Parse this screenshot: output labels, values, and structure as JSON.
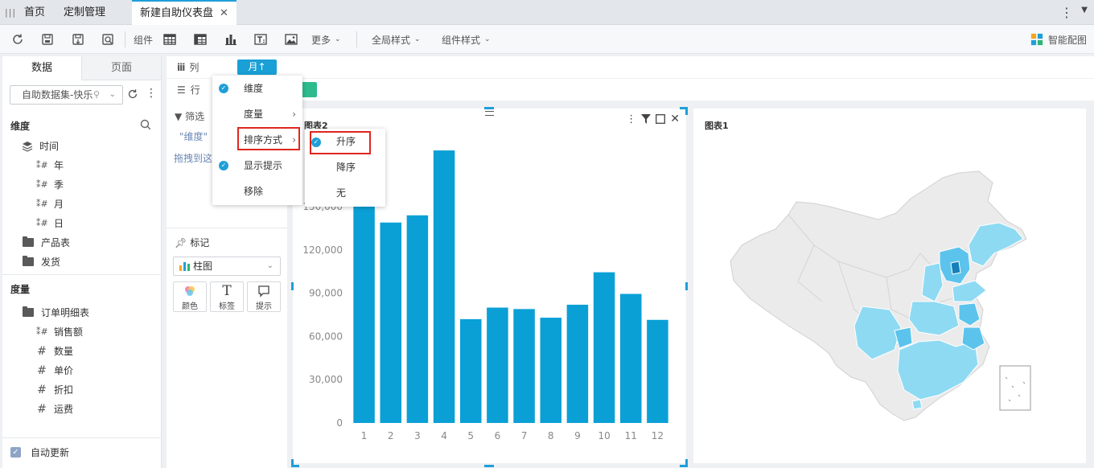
{
  "tabs": [
    {
      "label": "首页"
    },
    {
      "label": "定制管理"
    },
    {
      "label": "新建自助仪表盘",
      "active": true
    }
  ],
  "toolbar": {
    "component_label": "组件",
    "more_label": "更多",
    "global_style_label": "全局样式",
    "component_style_label": "组件样式",
    "smart_chart_label": "智能配图"
  },
  "left_panel": {
    "tab_data": "数据",
    "tab_page": "页面",
    "dataset": "自助数据集-快乐",
    "dimension_header": "维度",
    "dimension_items": [
      {
        "label": "时间",
        "icon": "layers-icon"
      },
      {
        "label": "年",
        "icon": "date-field-icon"
      },
      {
        "label": "季",
        "icon": "date-field-icon"
      },
      {
        "label": "月",
        "icon": "date-field-icon"
      },
      {
        "label": "日",
        "icon": "date-field-icon"
      },
      {
        "label": "产品表",
        "icon": "folder-icon"
      },
      {
        "label": "发货",
        "icon": "folder-icon"
      }
    ],
    "measure_header": "度量",
    "measure_items": [
      {
        "label": "订单明细表",
        "icon": "folder-icon"
      },
      {
        "label": "销售额",
        "icon": "number-field-icon"
      },
      {
        "label": "数量",
        "icon": "number-field-icon"
      },
      {
        "label": "单价",
        "icon": "number-field-icon"
      },
      {
        "label": "折扣",
        "icon": "number-field-icon"
      },
      {
        "label": "运费",
        "icon": "number-field-icon"
      }
    ],
    "auto_update": "自动更新"
  },
  "shelves": {
    "column_label": "列",
    "column_pill": "月↑",
    "row_label": "行"
  },
  "mid_panel": {
    "filter_label": "筛选",
    "dimension_hint": "\"维度\"",
    "drag_hint": "拖拽到这",
    "mark_label": "标记",
    "mark_type": "柱图",
    "mark_buttons": [
      {
        "label": "颜色"
      },
      {
        "label": "标签"
      },
      {
        "label": "提示"
      }
    ]
  },
  "context_menu": {
    "items": [
      {
        "label": "维度",
        "checked": true
      },
      {
        "label": "度量",
        "submenu": true
      },
      {
        "label": "排序方式",
        "submenu": true
      },
      {
        "label": "显示提示",
        "checked": true
      },
      {
        "label": "移除"
      }
    ],
    "sort_submenu": [
      {
        "label": "升序",
        "checked": true
      },
      {
        "label": "降序"
      },
      {
        "label": "无"
      }
    ]
  },
  "chart_data": {
    "type": "bar",
    "title": "图表2",
    "categories": [
      "1",
      "2",
      "3",
      "4",
      "5",
      "6",
      "7",
      "8",
      "9",
      "10",
      "11",
      "12"
    ],
    "values": [
      155000,
      139000,
      144000,
      189000,
      72000,
      80000,
      79000,
      73000,
      82000,
      104500,
      89500,
      71500
    ],
    "ylim": [
      0,
      150000
    ],
    "yticks": [
      0,
      30000,
      60000,
      90000,
      120000,
      150000
    ],
    "ytick_labels": [
      "0",
      "30,000",
      "60,000",
      "90,000",
      "120,000",
      "150,000"
    ],
    "bar_color": "#0aa0d6",
    "grid": false
  },
  "map_card": {
    "title": "图表1"
  },
  "colors": {
    "accent": "#1f9fd8",
    "bar": "#0aa0d6",
    "highlight_border": "#e0261f",
    "map_light": "#8fdaf3",
    "map_base": "#ebebeb"
  }
}
